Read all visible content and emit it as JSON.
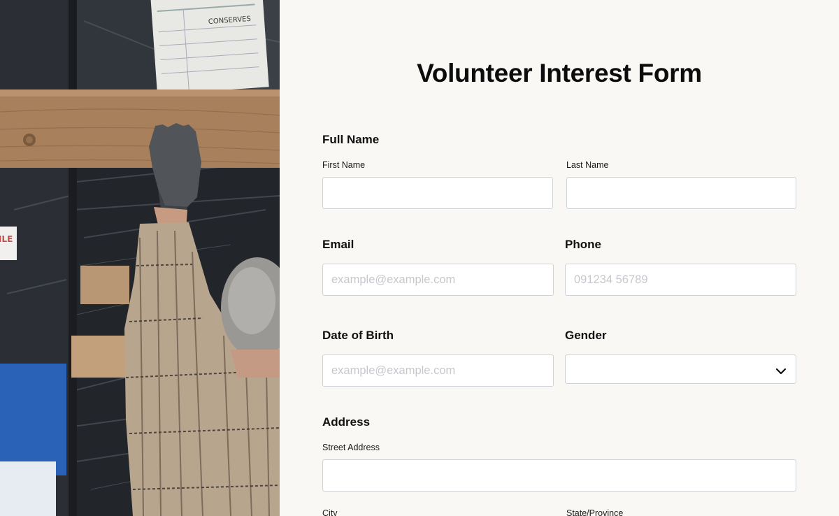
{
  "form": {
    "title": "Volunteer Interest Form",
    "full_name": {
      "label": "Full Name",
      "first_label": "First Name",
      "last_label": "Last Name",
      "first_value": "",
      "last_value": ""
    },
    "email": {
      "label": "Email",
      "placeholder": "example@example.com",
      "value": ""
    },
    "phone": {
      "label": "Phone",
      "placeholder": "091234 56789",
      "value": ""
    },
    "dob": {
      "label": "Date of Birth",
      "placeholder": "example@example.com",
      "value": ""
    },
    "gender": {
      "label": "Gender",
      "selected": ""
    },
    "address": {
      "label": "Address",
      "street_label": "Street Address",
      "street_value": "",
      "city_label": "City",
      "state_label": "State/Province"
    }
  },
  "photo": {
    "sign_text": "ILE",
    "label_text": "CONSERVES"
  },
  "icons": {
    "gender_dropdown": "chevron-down-icon"
  }
}
